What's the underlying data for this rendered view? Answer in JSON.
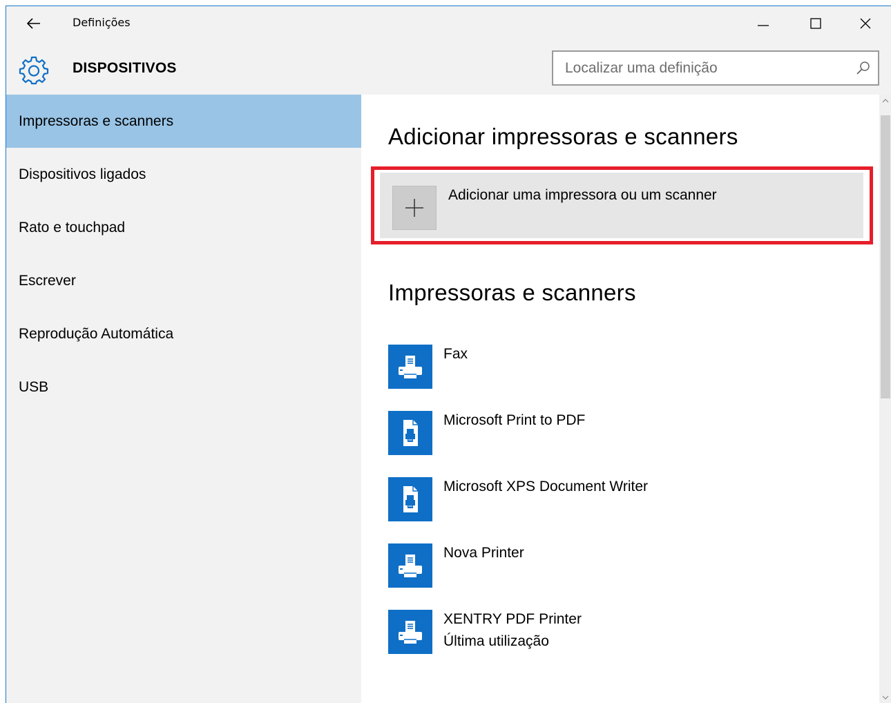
{
  "window": {
    "title": "Definições",
    "back_icon": "arrow-left-icon",
    "controls": [
      "minimize-icon",
      "maximize-icon",
      "close-icon"
    ]
  },
  "header": {
    "icon": "gear-icon",
    "title": "DISPOSITIVOS",
    "search_placeholder": "Localizar uma definição",
    "search_icon": "search-icon"
  },
  "sidebar": {
    "items": [
      {
        "label": "Impressoras e scanners",
        "active": true
      },
      {
        "label": "Dispositivos ligados",
        "active": false
      },
      {
        "label": "Rato e touchpad",
        "active": false
      },
      {
        "label": "Escrever",
        "active": false
      },
      {
        "label": "Reprodução Automática",
        "active": false
      },
      {
        "label": "USB",
        "active": false
      }
    ]
  },
  "main": {
    "add_section_title": "Adicionar impressoras e scanners",
    "add_button_label": "Adicionar uma impressora ou um scanner",
    "add_icon": "plus-icon",
    "list_section_title": "Impressoras e scanners",
    "printers": [
      {
        "name": "Fax",
        "icon": "printer-icon",
        "status": ""
      },
      {
        "name": "Microsoft Print to PDF",
        "icon": "document-printer-icon",
        "status": ""
      },
      {
        "name": "Microsoft XPS Document Writer",
        "icon": "document-printer-icon",
        "status": ""
      },
      {
        "name": "Nova Printer",
        "icon": "printer-icon",
        "status": ""
      },
      {
        "name": "XENTRY PDF Printer",
        "icon": "printer-icon",
        "status": "Última utilização"
      }
    ]
  },
  "colors": {
    "accent": "#0f6fc6",
    "sidebar_active": "#99c4e6",
    "highlight_outline": "#e61e2a",
    "background": "#f2f2f2"
  }
}
